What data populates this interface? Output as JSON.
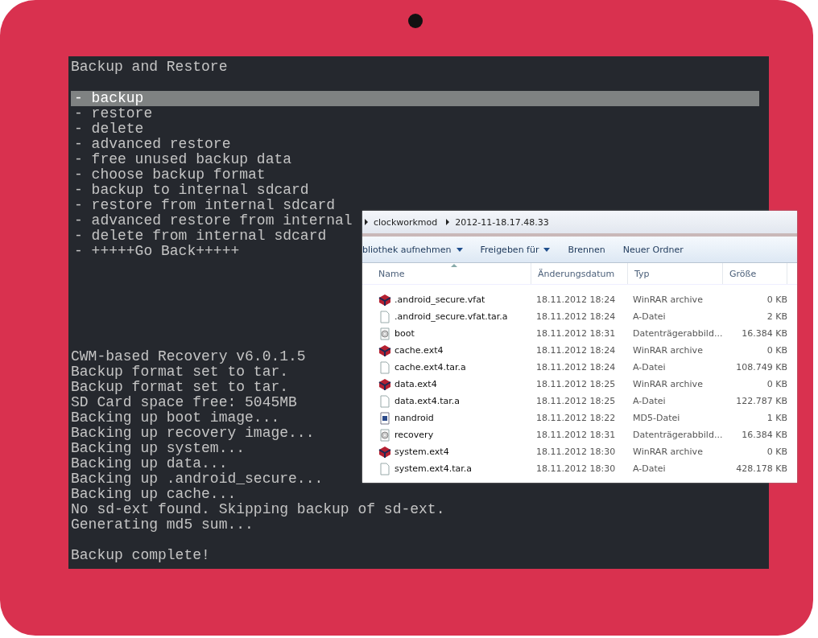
{
  "recovery": {
    "title": "Backup and Restore",
    "menu": [
      {
        "label": "- backup",
        "selected": true
      },
      {
        "label": "- restore",
        "selected": false
      },
      {
        "label": "- delete",
        "selected": false
      },
      {
        "label": "- advanced restore",
        "selected": false
      },
      {
        "label": "- free unused backup data",
        "selected": false
      },
      {
        "label": "- choose backup format",
        "selected": false
      },
      {
        "label": "- backup to internal sdcard",
        "selected": false
      },
      {
        "label": "- restore from internal sdcard",
        "selected": false
      },
      {
        "label": "- advanced restore from internal",
        "selected": false
      },
      {
        "label": "- delete from internal sdcard",
        "selected": false
      },
      {
        "label": "- +++++Go Back+++++",
        "selected": false
      }
    ],
    "log": [
      "CWM-based Recovery v6.0.1.5",
      "Backup format set to tar.",
      "Backup format set to tar.",
      "SD Card space free: 5045MB",
      "Backing up boot image...",
      "Backing up recovery image...",
      "Backing up system...",
      "Backing up data...",
      "Backing up .android_secure...",
      "Backing up cache...",
      "No sd-ext found. Skipping backup of sd-ext.",
      "Generating md5 sum..."
    ],
    "status": "Backup complete!"
  },
  "explorer": {
    "breadcrumbs": [
      "clockworkmod",
      "2012-11-18.17.48.33"
    ],
    "toolbar": [
      {
        "label": "bliothek aufnehmen",
        "dropdown": true
      },
      {
        "label": "Freigeben für",
        "dropdown": true
      },
      {
        "label": "Brennen",
        "dropdown": false
      },
      {
        "label": "Neuer Ordner",
        "dropdown": false
      }
    ],
    "columns": [
      "Name",
      "Änderungsdatum",
      "Typ",
      "Größe"
    ],
    "rows": [
      {
        "kind": "archive",
        "name": ".android_secure.vfat",
        "date": "18.11.2012 18:24",
        "type": "WinRAR archive",
        "size": "0 KB"
      },
      {
        "kind": "file",
        "name": ".android_secure.vfat.tar.a",
        "date": "18.11.2012 18:24",
        "type": "A-Datei",
        "size": "2 KB"
      },
      {
        "kind": "disc",
        "name": "boot",
        "date": "18.11.2012 18:31",
        "type": "Datenträgerabbild...",
        "size": "16.384 KB"
      },
      {
        "kind": "archive",
        "name": "cache.ext4",
        "date": "18.11.2012 18:24",
        "type": "WinRAR archive",
        "size": "0 KB"
      },
      {
        "kind": "file",
        "name": "cache.ext4.tar.a",
        "date": "18.11.2012 18:24",
        "type": "A-Datei",
        "size": "108.749 KB"
      },
      {
        "kind": "archive",
        "name": "data.ext4",
        "date": "18.11.2012 18:25",
        "type": "WinRAR archive",
        "size": "0 KB"
      },
      {
        "kind": "file",
        "name": "data.ext4.tar.a",
        "date": "18.11.2012 18:25",
        "type": "A-Datei",
        "size": "122.787 KB"
      },
      {
        "kind": "md5",
        "name": "nandroid",
        "date": "18.11.2012 18:22",
        "type": "MD5-Datei",
        "size": "1 KB"
      },
      {
        "kind": "disc",
        "name": "recovery",
        "date": "18.11.2012 18:31",
        "type": "Datenträgerabbild...",
        "size": "16.384 KB"
      },
      {
        "kind": "archive",
        "name": "system.ext4",
        "date": "18.11.2012 18:30",
        "type": "WinRAR archive",
        "size": "0 KB"
      },
      {
        "kind": "file",
        "name": "system.ext4.tar.a",
        "date": "18.11.2012 18:30",
        "type": "A-Datei",
        "size": "428.178 KB"
      }
    ]
  }
}
